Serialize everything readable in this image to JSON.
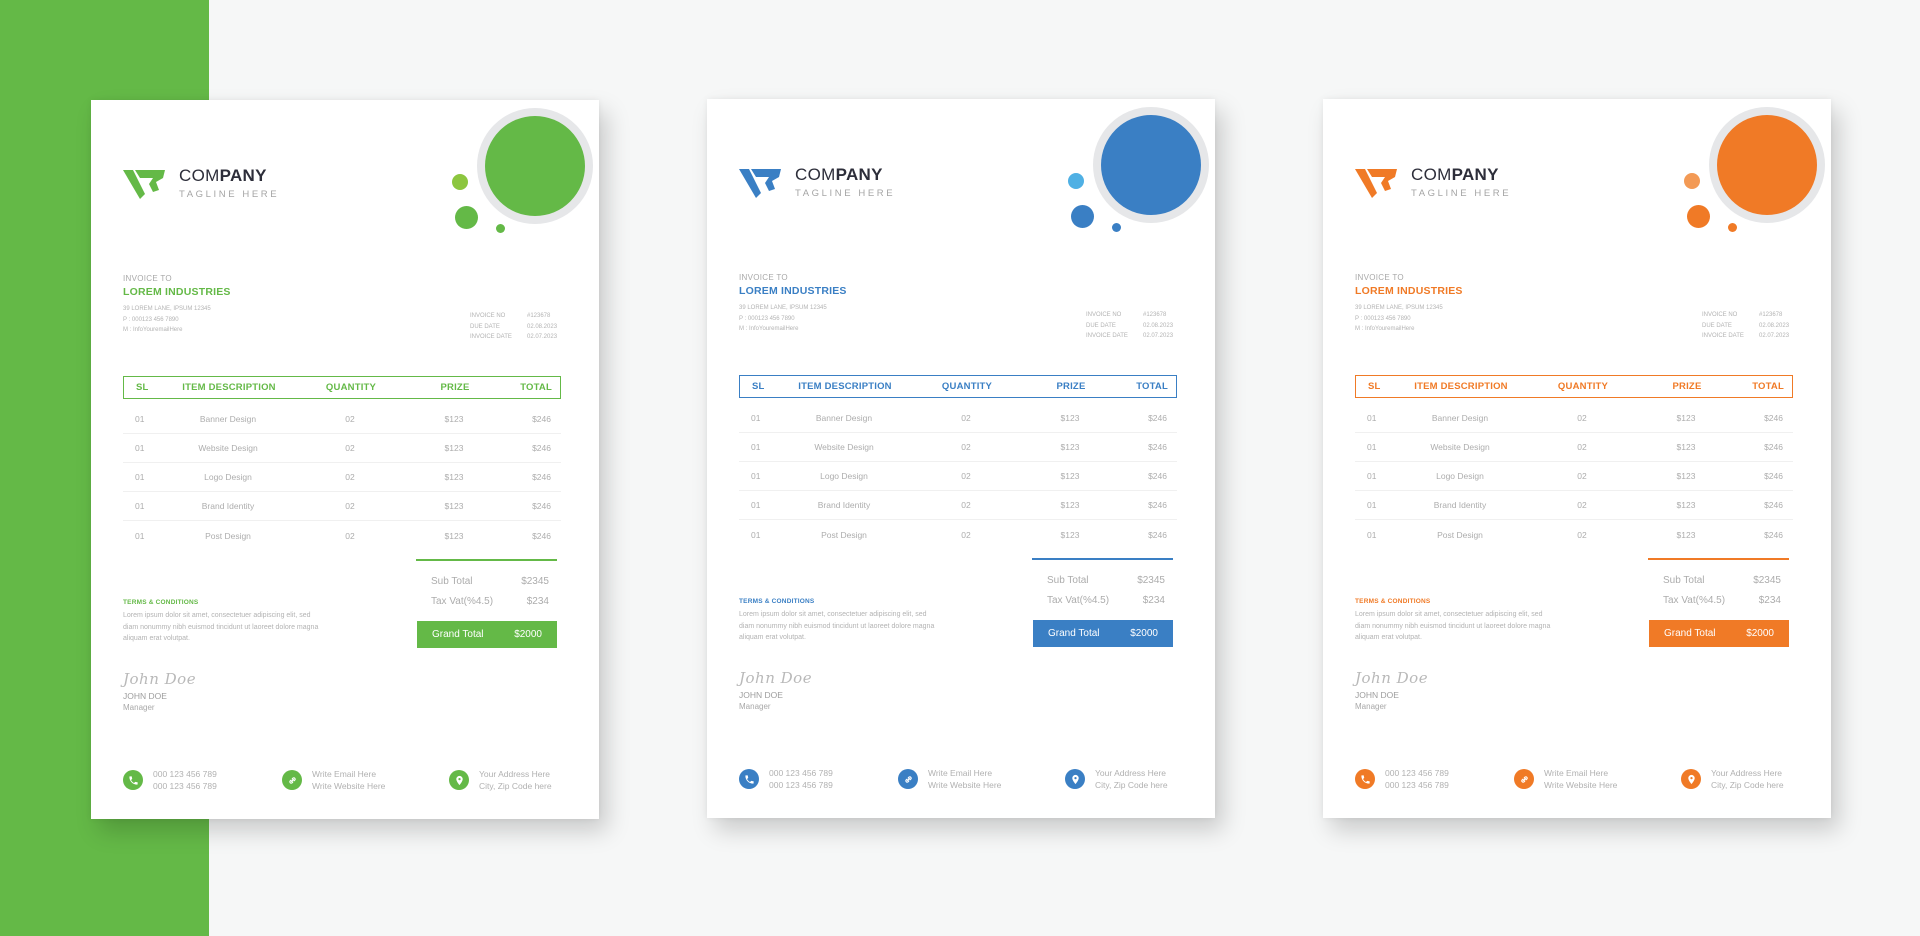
{
  "background": {
    "strip_color": "#64b947",
    "page_color": "#f6f7f7"
  },
  "invoices": [
    {
      "theme": "green",
      "accent": "#64b947",
      "accent_light": "#8cc63f",
      "brand": {
        "name_light": "COM",
        "name_bold": "PANY",
        "tagline": "TAGLINE HERE"
      },
      "invoice_to_label": "INVOICE TO",
      "client": "LOREM INDUSTRIES",
      "address": [
        "39 LOREM LANE, IPSUM 12345",
        "P : 000123 456 7890",
        "M : InfoYouremailHere"
      ],
      "meta": [
        {
          "label": "INVOICE NO",
          "value": "#123678"
        },
        {
          "label": "DUE DATE",
          "value": "02.08.2023"
        },
        {
          "label": "INVOICE DATE",
          "value": "02.07.2023"
        }
      ],
      "table": {
        "headers": [
          "SL",
          "ITEM DESCRIPTION",
          "QUANTITY",
          "PRIZE",
          "TOTAL"
        ],
        "rows": [
          [
            "01",
            "Banner Design",
            "02",
            "$123",
            "$246"
          ],
          [
            "01",
            "Website Design",
            "02",
            "$123",
            "$246"
          ],
          [
            "01",
            "Logo Design",
            "02",
            "$123",
            "$246"
          ],
          [
            "01",
            "Brand Identity",
            "02",
            "$123",
            "$246"
          ],
          [
            "01",
            "Post Design",
            "02",
            "$123",
            "$246"
          ]
        ]
      },
      "totals": {
        "sub_total_label": "Sub Total",
        "sub_total": "$2345",
        "tax_label": "Tax Vat(%4.5)",
        "tax": "$234",
        "grand_label": "Grand Total",
        "grand": "$2000"
      },
      "terms": {
        "title": "TERMS & CONDITIONS",
        "text": "Lorem ipsum dolor sit amet, consectetuer adipiscing elit, sed diam nonummy nibh euismod tincidunt ut laoreet dolore magna aliquam erat volutpat."
      },
      "signature": {
        "script": "John Doe",
        "name": "JOHN DOE",
        "role": "Manager"
      },
      "footer": [
        {
          "icon": "phone-icon",
          "lines": [
            "000 123 456 789",
            "000 123 456 789"
          ]
        },
        {
          "icon": "link-icon",
          "lines": [
            "Write Email Here",
            "Write Website Here"
          ]
        },
        {
          "icon": "location-pin-icon",
          "lines": [
            "Your Address Here",
            "City, Zip Code here"
          ]
        }
      ]
    },
    {
      "theme": "blue",
      "accent": "#3a7fc4",
      "accent_light": "#4fb0e4",
      "brand": {
        "name_light": "COM",
        "name_bold": "PANY",
        "tagline": "TAGLINE HERE"
      },
      "invoice_to_label": "INVOICE TO",
      "client": "LOREM INDUSTRIES",
      "address": [
        "39 LOREM LANE, IPSUM 12345",
        "P : 000123 456 7890",
        "M : InfoYouremailHere"
      ],
      "meta": [
        {
          "label": "INVOICE NO",
          "value": "#123678"
        },
        {
          "label": "DUE DATE",
          "value": "02.08.2023"
        },
        {
          "label": "INVOICE DATE",
          "value": "02.07.2023"
        }
      ],
      "table": {
        "headers": [
          "SL",
          "ITEM DESCRIPTION",
          "QUANTITY",
          "PRIZE",
          "TOTAL"
        ],
        "rows": [
          [
            "01",
            "Banner Design",
            "02",
            "$123",
            "$246"
          ],
          [
            "01",
            "Website Design",
            "02",
            "$123",
            "$246"
          ],
          [
            "01",
            "Logo Design",
            "02",
            "$123",
            "$246"
          ],
          [
            "01",
            "Brand Identity",
            "02",
            "$123",
            "$246"
          ],
          [
            "01",
            "Post Design",
            "02",
            "$123",
            "$246"
          ]
        ]
      },
      "totals": {
        "sub_total_label": "Sub Total",
        "sub_total": "$2345",
        "tax_label": "Tax Vat(%4.5)",
        "tax": "$234",
        "grand_label": "Grand Total",
        "grand": "$2000"
      },
      "terms": {
        "title": "TERMS & CONDITIONS",
        "text": "Lorem ipsum dolor sit amet, consectetuer adipiscing elit, sed diam nonummy nibh euismod tincidunt ut laoreet dolore magna aliquam erat volutpat."
      },
      "signature": {
        "script": "John Doe",
        "name": "JOHN DOE",
        "role": "Manager"
      },
      "footer": [
        {
          "icon": "phone-icon",
          "lines": [
            "000 123 456 789",
            "000 123 456 789"
          ]
        },
        {
          "icon": "link-icon",
          "lines": [
            "Write Email Here",
            "Write Website Here"
          ]
        },
        {
          "icon": "location-pin-icon",
          "lines": [
            "Your Address Here",
            "City, Zip Code here"
          ]
        }
      ]
    },
    {
      "theme": "orange",
      "accent": "#f07a26",
      "accent_light": "#f39a55",
      "brand": {
        "name_light": "COM",
        "name_bold": "PANY",
        "tagline": "TAGLINE HERE"
      },
      "invoice_to_label": "INVOICE TO",
      "client": "LOREM INDUSTRIES",
      "address": [
        "39 LOREM LANE, IPSUM 12345",
        "P : 000123 456 7890",
        "M : InfoYouremailHere"
      ],
      "meta": [
        {
          "label": "INVOICE NO",
          "value": "#123678"
        },
        {
          "label": "DUE DATE",
          "value": "02.08.2023"
        },
        {
          "label": "INVOICE DATE",
          "value": "02.07.2023"
        }
      ],
      "table": {
        "headers": [
          "SL",
          "ITEM DESCRIPTION",
          "QUANTITY",
          "PRIZE",
          "TOTAL"
        ],
        "rows": [
          [
            "01",
            "Banner Design",
            "02",
            "$123",
            "$246"
          ],
          [
            "01",
            "Website Design",
            "02",
            "$123",
            "$246"
          ],
          [
            "01",
            "Logo Design",
            "02",
            "$123",
            "$246"
          ],
          [
            "01",
            "Brand Identity",
            "02",
            "$123",
            "$246"
          ],
          [
            "01",
            "Post Design",
            "02",
            "$123",
            "$246"
          ]
        ]
      },
      "totals": {
        "sub_total_label": "Sub Total",
        "sub_total": "$2345",
        "tax_label": "Tax Vat(%4.5)",
        "tax": "$234",
        "grand_label": "Grand Total",
        "grand": "$2000"
      },
      "terms": {
        "title": "TERMS & CONDITIONS",
        "text": "Lorem ipsum dolor sit amet, consectetuer adipiscing elit, sed diam nonummy nibh euismod tincidunt ut laoreet dolore magna aliquam erat volutpat."
      },
      "signature": {
        "script": "John Doe",
        "name": "JOHN DOE",
        "role": "Manager"
      },
      "footer": [
        {
          "icon": "phone-icon",
          "lines": [
            "000 123 456 789",
            "000 123 456 789"
          ]
        },
        {
          "icon": "link-icon",
          "lines": [
            "Write Email Here",
            "Write Website Here"
          ]
        },
        {
          "icon": "location-pin-icon",
          "lines": [
            "Your Address Here",
            "City, Zip Code here"
          ]
        }
      ]
    }
  ]
}
